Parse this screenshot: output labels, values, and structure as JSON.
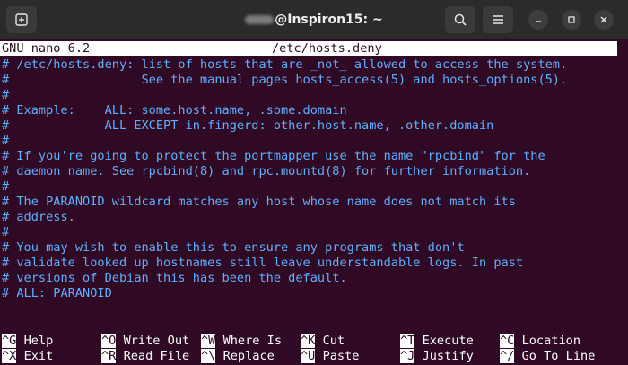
{
  "window": {
    "title_suffix": "@Inspiron15: ~",
    "icons": {
      "new_tab": "new-tab-icon",
      "search": "search-icon",
      "menu": "hamburger-menu-icon",
      "minimize": "minimize-icon",
      "maximize": "maximize-icon",
      "close": "close-icon"
    }
  },
  "nano": {
    "version": "GNU nano 6.2",
    "filename": "/etc/hosts.deny"
  },
  "file_lines": [
    "# /etc/hosts.deny: list of hosts that are _not_ allowed to access the system.",
    "#                  See the manual pages hosts_access(5) and hosts_options(5).",
    "#",
    "# Example:    ALL: some.host.name, .some.domain",
    "#             ALL EXCEPT in.fingerd: other.host.name, .other.domain",
    "#",
    "# If you're going to protect the portmapper use the name \"rpcbind\" for the",
    "# daemon name. See rpcbind(8) and rpc.mountd(8) for further information.",
    "#",
    "# The PARANOID wildcard matches any host whose name does not match its",
    "# address.",
    "#",
    "# You may wish to enable this to ensure any programs that don't",
    "# validate looked up hostnames still leave understandable logs. In past",
    "# versions of Debian this has been the default.",
    "# ALL: PARANOID"
  ],
  "shortcuts": {
    "row1": [
      {
        "key": "^G",
        "label": "Help"
      },
      {
        "key": "^O",
        "label": "Write Out"
      },
      {
        "key": "^W",
        "label": "Where Is"
      },
      {
        "key": "^K",
        "label": "Cut"
      },
      {
        "key": "^T",
        "label": "Execute"
      },
      {
        "key": "^C",
        "label": "Location"
      }
    ],
    "row2": [
      {
        "key": "^X",
        "label": "Exit"
      },
      {
        "key": "^R",
        "label": "Read File"
      },
      {
        "key": "^\\",
        "label": "Replace"
      },
      {
        "key": "^U",
        "label": "Paste"
      },
      {
        "key": "^J",
        "label": "Justify"
      },
      {
        "key": "^/",
        "label": "Go To Line"
      }
    ]
  },
  "colors": {
    "background": "#300a24",
    "comment": "#5fafff",
    "header_bg": "#ffffff",
    "titlebar": "#2b2b2b"
  }
}
